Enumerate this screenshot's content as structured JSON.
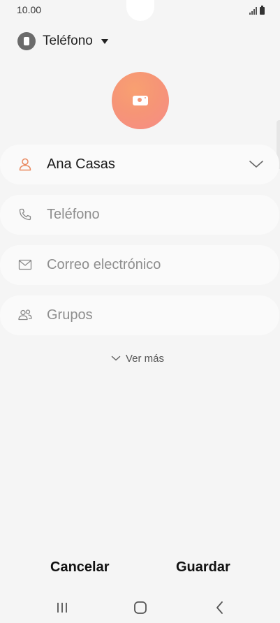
{
  "status_bar": {
    "time": "10.00",
    "icons": [
      "signal-icon",
      "battery-icon"
    ]
  },
  "account": {
    "label": "Teléfono",
    "icon": "phone-storage-icon"
  },
  "photo": {
    "icon": "camera-icon",
    "gradient": [
      "#f8a071",
      "#f58c86"
    ]
  },
  "fields": {
    "name": {
      "value": "Ana Casas",
      "icon": "person-icon",
      "accent": "#e9895f"
    },
    "phone": {
      "placeholder": "Teléfono",
      "icon": "phone-icon"
    },
    "email": {
      "placeholder": "Correo electrónico",
      "icon": "mail-icon"
    },
    "groups": {
      "placeholder": "Grupos",
      "icon": "group-icon"
    }
  },
  "see_more": {
    "label": "Ver más"
  },
  "actions": {
    "cancel_label": "Cancelar",
    "save_label": "Guardar"
  },
  "navbar": {
    "items": [
      "recents-icon",
      "home-icon",
      "back-icon"
    ]
  }
}
